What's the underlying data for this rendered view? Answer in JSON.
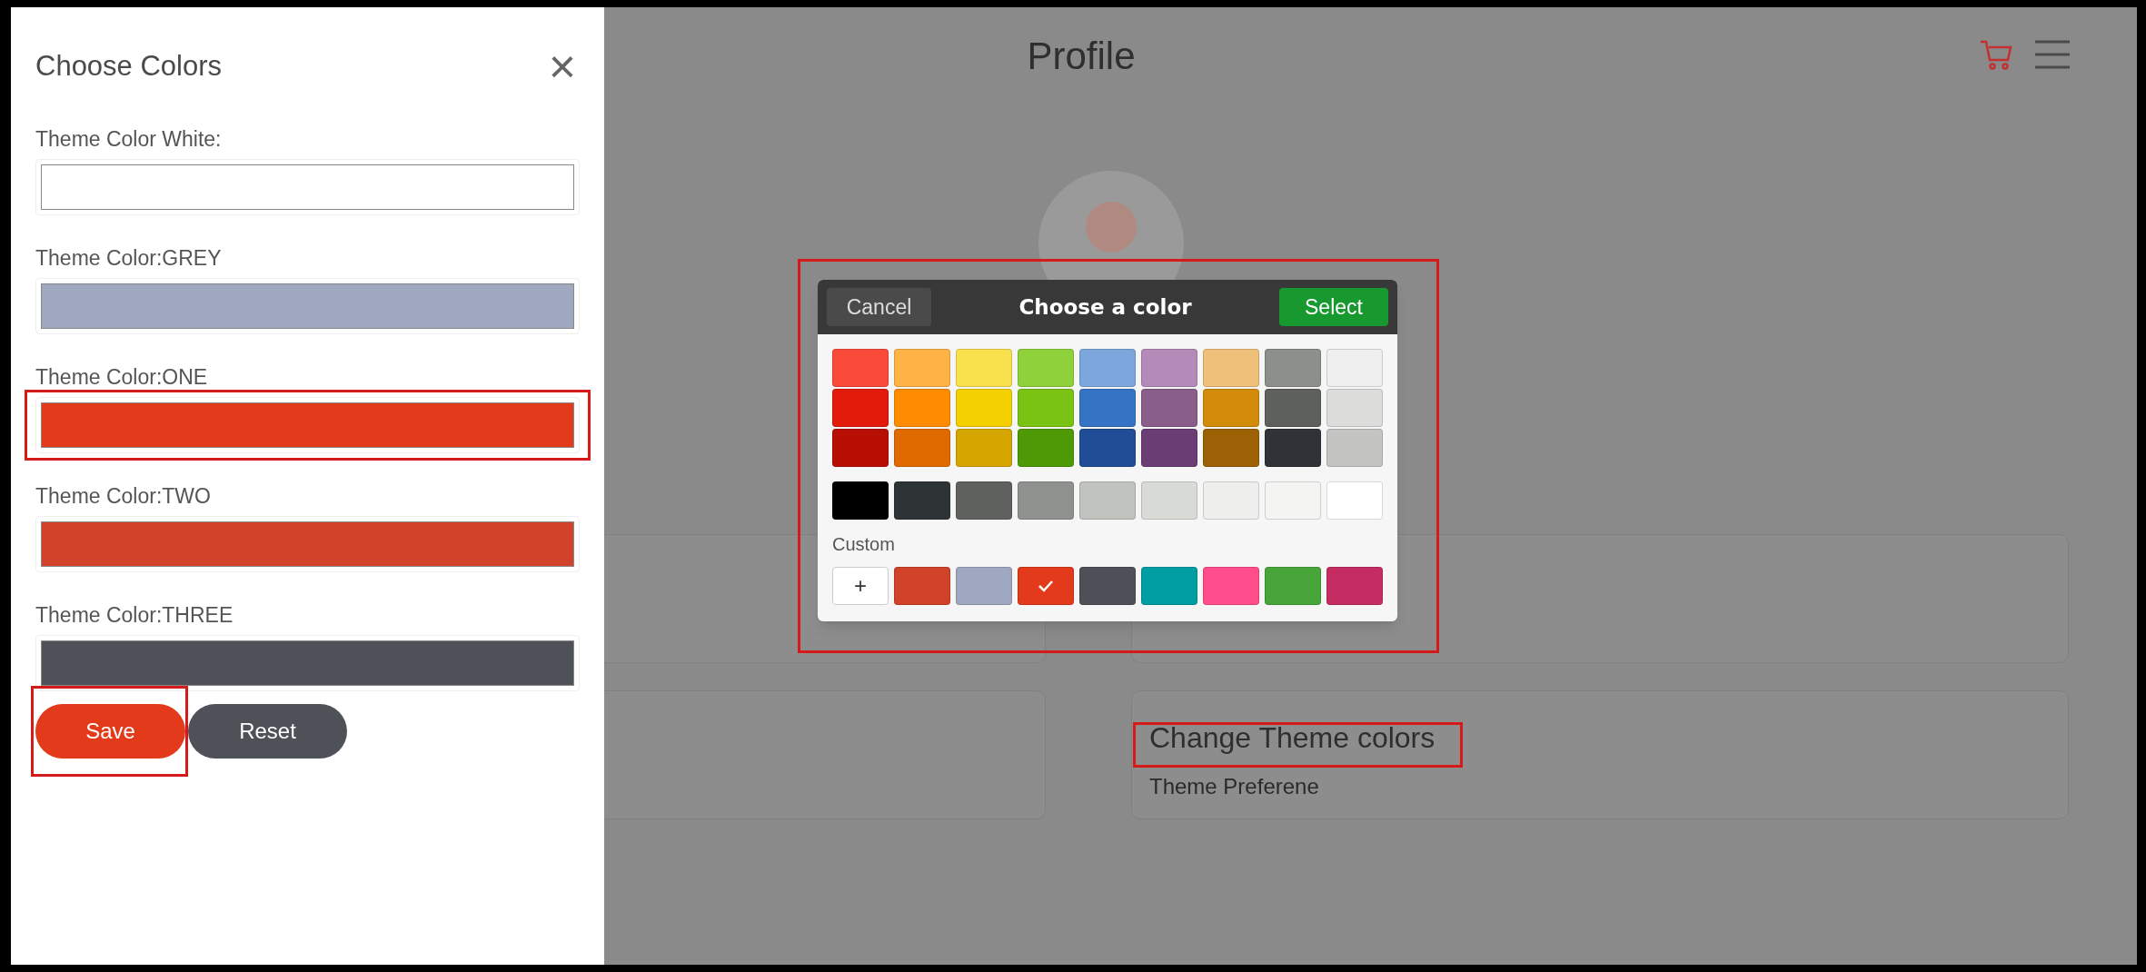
{
  "side_panel": {
    "title": "Choose Colors",
    "close": "×",
    "fields": [
      {
        "label": "Theme Color White:",
        "color": "#ffffff",
        "highlighted": false
      },
      {
        "label": "Theme Color:GREY",
        "color": "#a0a8c0",
        "highlighted": false
      },
      {
        "label": "Theme Color:ONE",
        "color": "#e23a1b",
        "highlighted": true
      },
      {
        "label": "Theme Color:TWO",
        "color": "#d0432a",
        "highlighted": false
      },
      {
        "label": "Theme Color:THREE",
        "color": "#4e5258",
        "highlighted": false
      }
    ],
    "buttons": [
      {
        "label": "Save",
        "kind": "primary",
        "highlighted": true
      },
      {
        "label": "Reset",
        "kind": "secondary",
        "highlighted": false
      }
    ]
  },
  "page": {
    "title": "Profile",
    "cards": [
      {
        "title": "Change Theme colors",
        "subtitle": "Theme Preferene",
        "highlighted": true
      }
    ]
  },
  "color_dialog": {
    "title": "Choose a color",
    "cancel": "Cancel",
    "select": "Select",
    "highlighted": true,
    "palette": [
      [
        {
          "color": "#f94a3a"
        },
        {
          "color": "#ffb347"
        },
        {
          "color": "#f9e04d"
        },
        {
          "color": "#8fd13a"
        },
        {
          "color": "#7ba7dc"
        },
        {
          "color": "#b48ab8"
        },
        {
          "color": "#efc07a"
        },
        {
          "color": "#8d8f8b"
        },
        {
          "color": "#efefef"
        }
      ],
      [
        {
          "color": "#e31b0a"
        },
        {
          "color": "#ff8c00"
        },
        {
          "color": "#f3d000"
        },
        {
          "color": "#7ac314"
        },
        {
          "color": "#3574c4"
        },
        {
          "color": "#8a5e8a"
        },
        {
          "color": "#d28b0a"
        },
        {
          "color": "#5e605c"
        },
        {
          "color": "#dcdddb"
        }
      ],
      [
        {
          "color": "#b80f05"
        },
        {
          "color": "#e06a00"
        },
        {
          "color": "#d5a500"
        },
        {
          "color": "#4e9a06"
        },
        {
          "color": "#1f4e96"
        },
        {
          "color": "#6a3d74"
        },
        {
          "color": "#9b6104"
        },
        {
          "color": "#2f3337"
        },
        {
          "color": "#c4c5c2"
        }
      ],
      [
        {
          "color": "#000000"
        },
        {
          "color": "#2e3436"
        },
        {
          "color": "#5f615f"
        },
        {
          "color": "#8f918e"
        },
        {
          "color": "#c1c3be"
        },
        {
          "color": "#d9dbd6"
        },
        {
          "color": "#eeeeec"
        },
        {
          "color": "#f4f4f3"
        },
        {
          "color": "#ffffff"
        }
      ]
    ],
    "custom_label": "Custom",
    "custom": [
      {
        "kind": "add",
        "label": "+"
      },
      {
        "kind": "swatch",
        "color": "#d0432a",
        "selected": false
      },
      {
        "kind": "swatch",
        "color": "#9fa8c0",
        "selected": false
      },
      {
        "kind": "swatch",
        "color": "#e23a1b",
        "selected": true
      },
      {
        "kind": "swatch",
        "color": "#4e5058",
        "selected": false
      },
      {
        "kind": "swatch",
        "color": "#009ea3",
        "selected": false
      },
      {
        "kind": "swatch",
        "color": "#ff4c8a",
        "selected": false
      },
      {
        "kind": "swatch",
        "color": "#47a53a",
        "selected": false
      },
      {
        "kind": "swatch",
        "color": "#c52d62",
        "selected": false
      }
    ]
  }
}
